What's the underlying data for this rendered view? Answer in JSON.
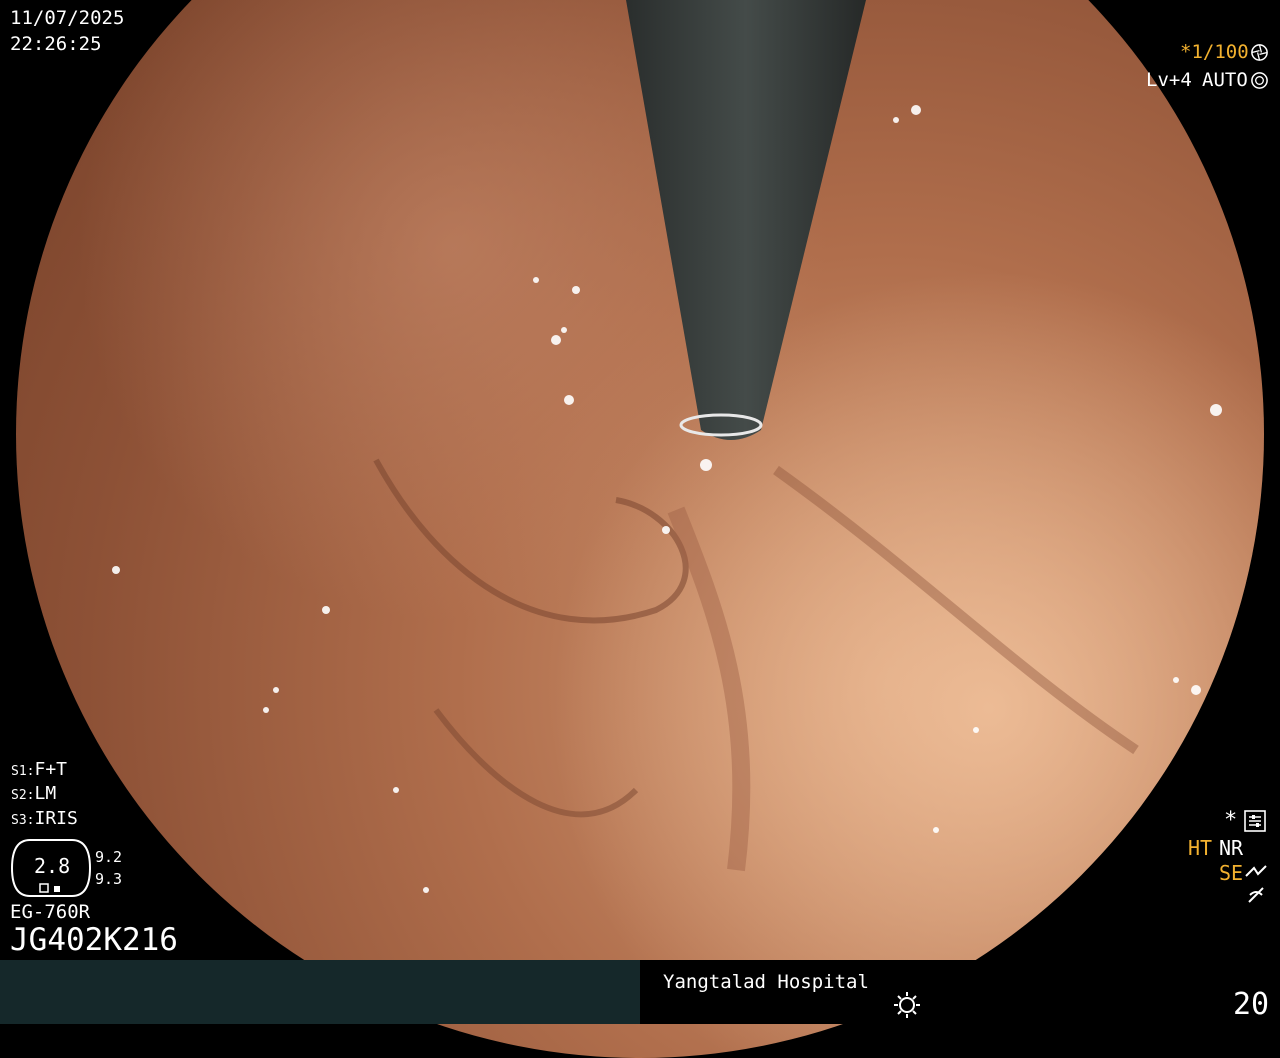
{
  "overlay": {
    "date": "11/07/2025",
    "time": "22:26:25",
    "shutter": "*1/100",
    "level": "Lv+4",
    "mode": "AUTO",
    "s1": "F+T",
    "s2": "LM",
    "s3": "IRIS",
    "s1_key": "S1:",
    "s2_key": "S2:",
    "s3_key": "S3:",
    "dial_value": "2.8",
    "dial_right_top": "9.2",
    "dial_right_bottom": "9.3",
    "scope_model": "EG-760R",
    "scope_serial": "JG402K216",
    "star": "*",
    "ht": "HT",
    "nr": "NR",
    "se": "SE",
    "hospital": "Yangtalad Hospital",
    "counter": "20"
  },
  "colors": {
    "footer_left": "#15282a",
    "accent_orange": "#f2b12f",
    "mucosa": "#b06e4c"
  },
  "icons": [
    "aperture-icon",
    "iris-icon",
    "settings-icon",
    "enhance-icon",
    "freeze-icon",
    "light-icon"
  ]
}
